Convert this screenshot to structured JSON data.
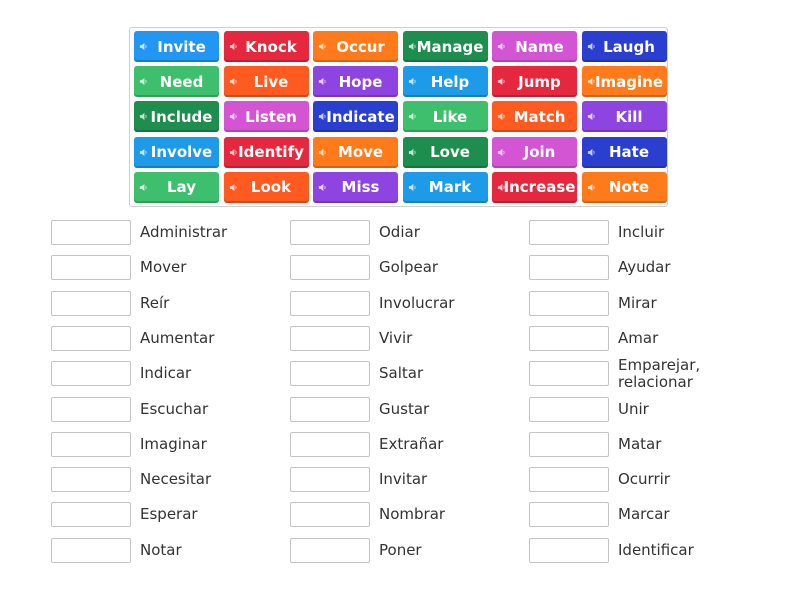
{
  "tiles": [
    {
      "label": "Invite",
      "color": "#2196f3"
    },
    {
      "label": "Knock",
      "color": "#e5283d"
    },
    {
      "label": "Occur",
      "color": "#ff7a1a"
    },
    {
      "label": "Manage",
      "color": "#1e8e4e"
    },
    {
      "label": "Name",
      "color": "#d455d4"
    },
    {
      "label": "Laugh",
      "color": "#2a3fcf"
    },
    {
      "label": "Need",
      "color": "#3dbf6d"
    },
    {
      "label": "Live",
      "color": "#ff5a1f"
    },
    {
      "label": "Hope",
      "color": "#8e44e0"
    },
    {
      "label": "Help",
      "color": "#1e9be8"
    },
    {
      "label": "Jump",
      "color": "#e5283d"
    },
    {
      "label": "Imagine",
      "color": "#ff7a1a"
    },
    {
      "label": "Include",
      "color": "#1e8e4e"
    },
    {
      "label": "Listen",
      "color": "#d455d4"
    },
    {
      "label": "Indicate",
      "color": "#2a3fcf"
    },
    {
      "label": "Like",
      "color": "#3dbf6d"
    },
    {
      "label": "Match",
      "color": "#ff5a1f"
    },
    {
      "label": "Kill",
      "color": "#8e44e0"
    },
    {
      "label": "Involve",
      "color": "#1e9be8"
    },
    {
      "label": "Identify",
      "color": "#e5283d"
    },
    {
      "label": "Move",
      "color": "#ff7a1a"
    },
    {
      "label": "Love",
      "color": "#1e8e4e"
    },
    {
      "label": "Join",
      "color": "#d455d4"
    },
    {
      "label": "Hate",
      "color": "#2a3fcf"
    },
    {
      "label": "Lay",
      "color": "#3dbf6d"
    },
    {
      "label": "Look",
      "color": "#ff5a1f"
    },
    {
      "label": "Miss",
      "color": "#8e44e0"
    },
    {
      "label": "Mark",
      "color": "#1e9be8"
    },
    {
      "label": "Increase",
      "color": "#e5283d"
    },
    {
      "label": "Note",
      "color": "#ff7a1a"
    }
  ],
  "targets": [
    [
      "Administrar",
      "Mover",
      "Reír",
      "Aumentar",
      "Indicar",
      "Escuchar",
      "Imaginar",
      "Necesitar",
      "Esperar",
      "Notar"
    ],
    [
      "Odiar",
      "Golpear",
      "Involucrar",
      "Vivir",
      "Saltar",
      "Gustar",
      "Extrañar",
      "Invitar",
      "Nombrar",
      "Poner"
    ],
    [
      "Incluir",
      "Ayudar",
      "Mirar",
      "Amar",
      "Emparejar, relacionar",
      "Unir",
      "Matar",
      "Ocurrir",
      "Marcar",
      "Identificar"
    ]
  ],
  "icons": {
    "tile_speaker": "speaker-icon"
  }
}
